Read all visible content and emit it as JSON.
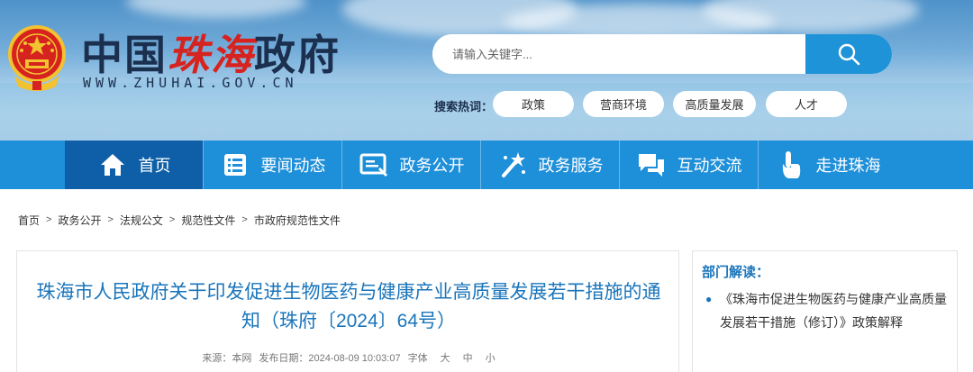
{
  "site": {
    "logo_part1": "中国",
    "logo_part2": "珠海",
    "logo_part3": "政府",
    "url": "WWW.ZHUHAI.GOV.CN"
  },
  "search": {
    "placeholder": "请输入关键字..."
  },
  "hot": {
    "label": "搜索热词：",
    "tags": [
      "政策",
      "营商环境",
      "高质量发展",
      "人才"
    ]
  },
  "nav": {
    "items": [
      {
        "label": "首页",
        "icon": "home-icon"
      },
      {
        "label": "要闻动态",
        "icon": "news-list-icon"
      },
      {
        "label": "政务公开",
        "icon": "document-icon"
      },
      {
        "label": "政务服务",
        "icon": "wand-icon"
      },
      {
        "label": "互动交流",
        "icon": "chat-icon"
      },
      {
        "label": "走进珠海",
        "icon": "tap-hand-icon"
      }
    ]
  },
  "breadcrumb": [
    "首页",
    "政务公开",
    "法规公文",
    "规范性文件",
    "市政府规范性文件"
  ],
  "breadcrumb_separator": ">",
  "article": {
    "title": "珠海市人民政府关于印发促进生物医药与健康产业高质量发展若干措施的通知（珠府〔2024〕64号）",
    "source_label": "来源：本网",
    "date_label": "发布日期：2024-08-09 10:03:07",
    "font_label": "字体",
    "font_sizes": [
      "大",
      "中",
      "小"
    ]
  },
  "sidebar": {
    "heading": "部门解读：",
    "item": "《珠海市促进生物医药与健康产业高质量发展若干措施（修订）》政策解释",
    "bullet": "●"
  },
  "colors": {
    "nav_bg": "#1e8fd9",
    "nav_active": "#0f5fa8",
    "title_blue": "#1a75bb",
    "logo_red": "#d7231f"
  }
}
